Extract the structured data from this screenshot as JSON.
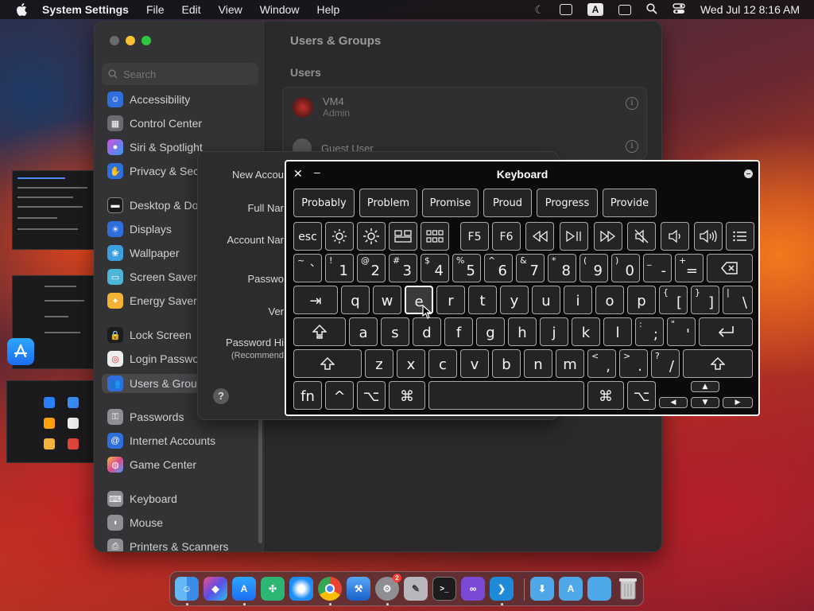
{
  "menubar": {
    "app_name": "System Settings",
    "menus": [
      "File",
      "Edit",
      "View",
      "Window",
      "Help"
    ],
    "input_source": "A",
    "datetime": "Wed Jul 12  8:16 AM"
  },
  "settings": {
    "search_placeholder": "Search",
    "sidebar_items": [
      "Accessibility",
      "Control Center",
      "Siri & Spotlight",
      "Privacy & Secu",
      "Desktop & Doc",
      "Displays",
      "Wallpaper",
      "Screen Saver",
      "Energy Saver",
      "Lock Screen",
      "Login Passwo",
      "Users & Group",
      "Passwords",
      "Internet Accounts",
      "Game Center",
      "Keyboard",
      "Mouse",
      "Printers & Scanners"
    ],
    "active_item": "Users & Group",
    "pane_title": "Users & Groups",
    "users_heading": "Users",
    "users": [
      {
        "name": "VM4",
        "role": "Admin"
      },
      {
        "name": "Guest User",
        "role": ""
      }
    ],
    "info_glyph": "i"
  },
  "new_account_sheet": {
    "labels": [
      "New Accou",
      "Full Nar",
      "Account Nar",
      "Passwo",
      "Ver",
      "Password Hi"
    ],
    "hint_sub": "(Recommend",
    "help": "?"
  },
  "keyboard_viewer": {
    "title": "Keyboard",
    "close_glyph": "✕",
    "minimize_glyph": "–",
    "suggestions": [
      "Probably",
      "Problem",
      "Promise",
      "Proud",
      "Progress",
      "Provide"
    ],
    "fn_row": [
      "esc",
      "F5",
      "F6"
    ],
    "number_row": [
      {
        "shift": "~",
        "main": "`"
      },
      {
        "shift": "!",
        "main": "1"
      },
      {
        "shift": "@",
        "main": "2"
      },
      {
        "shift": "#",
        "main": "3"
      },
      {
        "shift": "$",
        "main": "4"
      },
      {
        "shift": "%",
        "main": "5"
      },
      {
        "shift": "^",
        "main": "6"
      },
      {
        "shift": "&",
        "main": "7"
      },
      {
        "shift": "*",
        "main": "8"
      },
      {
        "shift": "(",
        "main": "9"
      },
      {
        "shift": ")",
        "main": "0"
      },
      {
        "shift": "_",
        "main": "-"
      },
      {
        "shift": "+",
        "main": "="
      }
    ],
    "qwerty_row": [
      "q",
      "w",
      "e",
      "r",
      "t",
      "y",
      "u",
      "i",
      "o",
      "p"
    ],
    "qwerty_extra": [
      {
        "shift": "{",
        "main": "["
      },
      {
        "shift": "}",
        "main": "]"
      },
      {
        "shift": "|",
        "main": "\\"
      }
    ],
    "home_row": [
      "a",
      "s",
      "d",
      "f",
      "g",
      "h",
      "j",
      "k",
      "l"
    ],
    "home_extra": [
      {
        "shift": ":",
        "main": ";"
      },
      {
        "shift": "\"",
        "main": "'"
      }
    ],
    "bottom_row": [
      "z",
      "x",
      "c",
      "v",
      "b",
      "n",
      "m"
    ],
    "bottom_extra": [
      {
        "shift": "<",
        "main": ","
      },
      {
        "shift": ">",
        "main": "."
      },
      {
        "shift": "?",
        "main": "/"
      }
    ],
    "modifiers": {
      "fn": "fn",
      "control": "^",
      "option": "⌥",
      "command": "⌘",
      "tab": "⇥",
      "return": "⏎"
    },
    "highlighted_key": "e"
  },
  "dock": {
    "apps": [
      "Finder",
      "Shortcuts",
      "App Store",
      "Klokki",
      "Safari",
      "Chrome",
      "Xcode",
      "System Settings",
      "Utilities",
      "Terminal",
      "Visual Studio",
      "VS Code"
    ],
    "folders": [
      "Downloads",
      "Applications",
      "Documents"
    ],
    "trash": "Trash",
    "badge_count": "2"
  }
}
